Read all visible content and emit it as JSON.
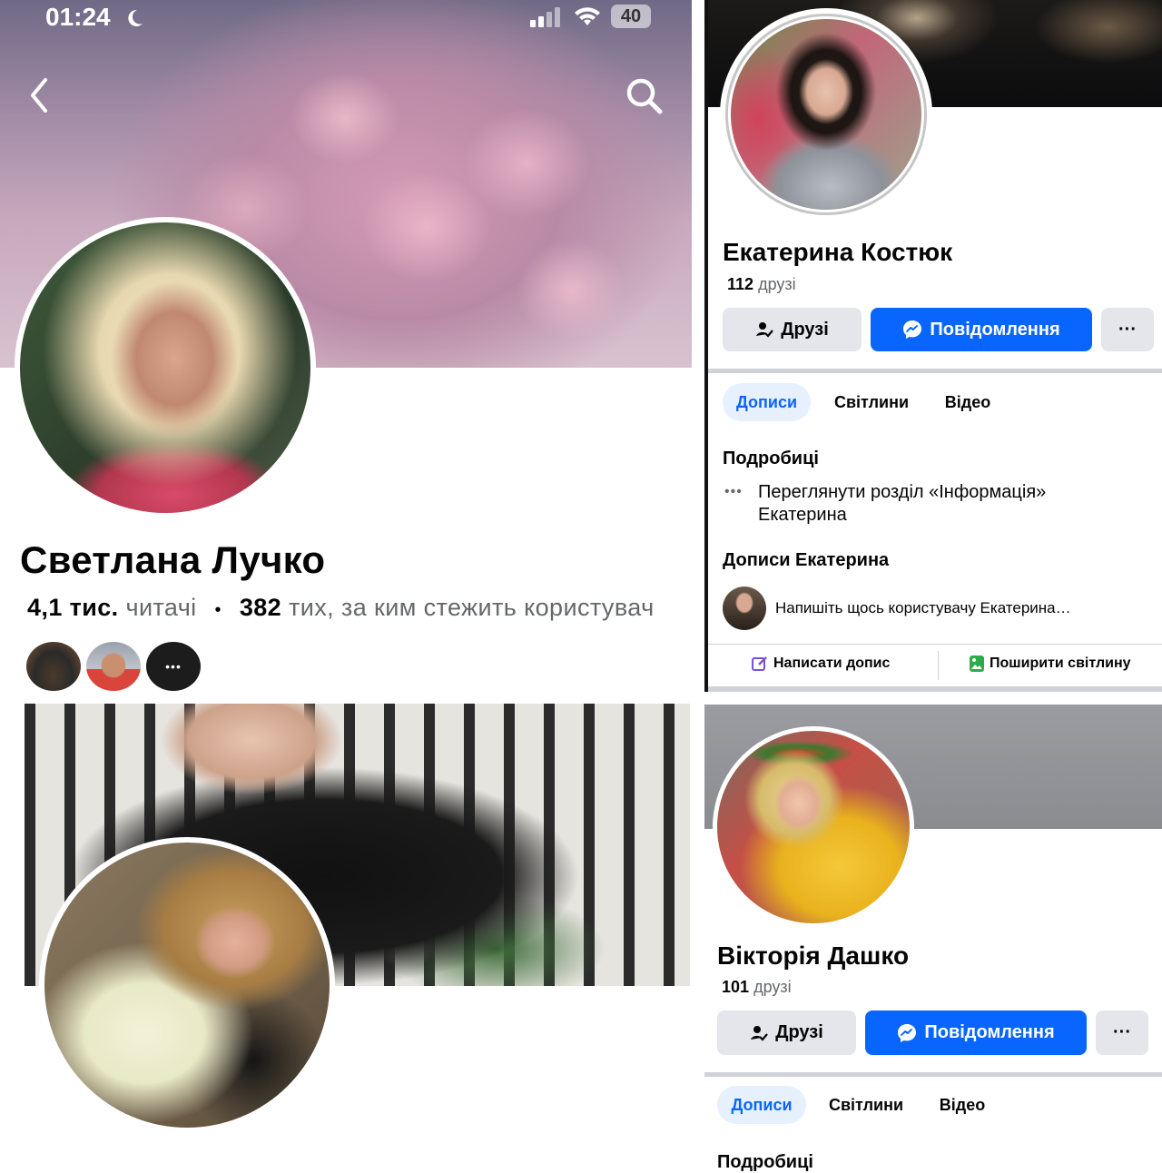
{
  "status_bar": {
    "time": "01:24",
    "battery": "40"
  },
  "profile_1": {
    "name": "Светлана Лучко",
    "followers_count": "4,1 тис.",
    "followers_label": "читачі",
    "separator": "•",
    "following_count": "382",
    "following_label": "тих, за ким стежить користувач",
    "more_glyph": "•••"
  },
  "profile_2": {
    "name": "Екатерина Костюк",
    "friends_count": "112",
    "friends_label": "друзі",
    "friends_button": "Друзі",
    "message_button": "Повідомлення",
    "more_button": "···",
    "tabs": [
      "Дописи",
      "Світлини",
      "Відео"
    ],
    "details_heading": "Подробиці",
    "details_link_line1": "Переглянути розділ «Інформація»",
    "details_link_line2": "Екатерина",
    "posts_heading": "Дописи Екатерина",
    "composer_placeholder": "Напишіть щось користувачу Екатерина…",
    "write_post": "Написати допис",
    "share_photo": "Поширити світлину"
  },
  "profile_3": {
    "name": "Вікторія Дашко",
    "friends_count": "101",
    "friends_label": "друзі",
    "friends_button": "Друзі",
    "message_button": "Повідомлення",
    "more_button": "···",
    "tabs": [
      "Дописи",
      "Світлини",
      "Відео"
    ],
    "details_heading": "Подробиці"
  },
  "colors": {
    "accent": "#0866ff",
    "button_gray": "#e4e6eb",
    "tab_active_bg": "#e7f0fe"
  }
}
